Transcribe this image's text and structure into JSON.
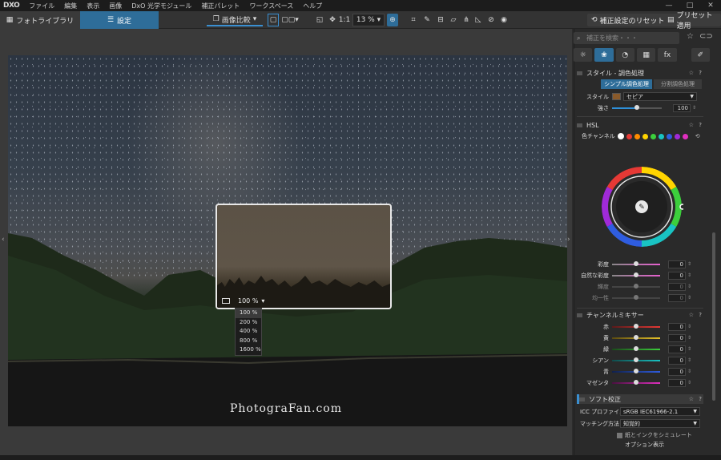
{
  "app": {
    "logo": "DXO",
    "window_controls": [
      "—",
      "□",
      "✕"
    ]
  },
  "menu": [
    "ファイル",
    "編集",
    "表示",
    "画像",
    "DxO 光学モジュール",
    "補正パレット",
    "ワークスペース",
    "ヘルプ"
  ],
  "tabs": {
    "library": "フォトライブラリ",
    "settings": "設定"
  },
  "toolbar": {
    "compare_label": "画像比較",
    "one_to_one": "1:1",
    "zoom_value": "13 %",
    "reset_label": "補正設定のリセット",
    "preset_label": "プリセット適用"
  },
  "loupe": {
    "zoom_current": "100 %",
    "zoom_options": [
      "100 %",
      "200 %",
      "400 %",
      "800 %",
      "1600 %"
    ]
  },
  "watermark": "PhotograFan.com",
  "panel": {
    "search_placeholder": "補正を検索・・・",
    "tab_icons": [
      "sun-icon",
      "color-circles-icon",
      "detail-icon",
      "geometry-icon",
      "fx-icon",
      "brush-icon"
    ],
    "tab_fx_label": "fx",
    "style_section": {
      "title": "スタイル - 調色処理",
      "seg_a": "シンプル調色処理",
      "seg_b": "分割調色処理",
      "style_label": "スタイル",
      "style_value": "セピア",
      "style_color": "#8a5a2a",
      "strength_label": "強さ",
      "strength_value": "100"
    },
    "hsl_section": {
      "title": "HSL",
      "channel_label": "色チャンネル",
      "channel_colors": [
        "#ffffff",
        "#e53935",
        "#ff8c00",
        "#ffd400",
        "#3ccf3c",
        "#19c3c3",
        "#2f5de0",
        "#a02ad8",
        "#e02fbf"
      ],
      "sliders": [
        {
          "label": "彩度",
          "value": "0",
          "dim": false
        },
        {
          "label": "自然な彩度",
          "value": "0",
          "dim": false
        },
        {
          "label": "輝度",
          "value": "0",
          "dim": true
        },
        {
          "label": "均一性",
          "value": "0",
          "dim": true
        }
      ]
    },
    "mixer_section": {
      "title": "チャンネルミキサー",
      "rows": [
        {
          "label": "赤",
          "value": "0",
          "color": "#e53935"
        },
        {
          "label": "黄",
          "value": "0",
          "color": "#e6c229"
        },
        {
          "label": "緑",
          "value": "0",
          "color": "#3ccf3c"
        },
        {
          "label": "シアン",
          "value": "0",
          "color": "#19c3c3"
        },
        {
          "label": "青",
          "value": "0",
          "color": "#2f5de0"
        },
        {
          "label": "マゼンタ",
          "value": "0",
          "color": "#e02fbf"
        }
      ]
    },
    "softproof_section": {
      "title": "ソフト校正",
      "icc_label": "ICC プロファイル",
      "icc_value": "sRGB IEC61966-2.1",
      "match_label": "マッチング方法",
      "match_value": "知覚的",
      "simulate_label": "紙とインクをシミュレート",
      "options_label": "オプション表示"
    }
  }
}
